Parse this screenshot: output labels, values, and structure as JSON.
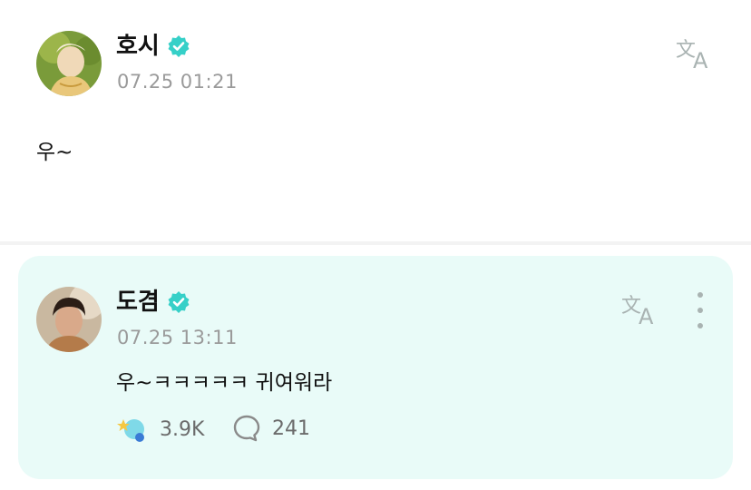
{
  "post": {
    "author": "호시",
    "timestamp": "07.25 01:21",
    "text": "우~",
    "verified_icon": "verified-badge-icon",
    "translate_icon": "translate-icon"
  },
  "comment": {
    "author": "도겸",
    "timestamp": "07.25 13:11",
    "text": "우~ㅋㅋㅋㅋㅋ 귀여워라",
    "likes": "3.9K",
    "replies": "241",
    "verified_icon": "verified-badge-icon",
    "translate_icon": "translate-icon",
    "more_icon": "more-vertical-icon",
    "like_icon": "reaction-icon",
    "reply_icon": "comment-bubble-icon"
  },
  "colors": {
    "verified": "#36d0c8",
    "comment_bg": "#e9fbf8",
    "timestamp": "#9a9a9a",
    "icon_gray": "#a9b3b2"
  }
}
